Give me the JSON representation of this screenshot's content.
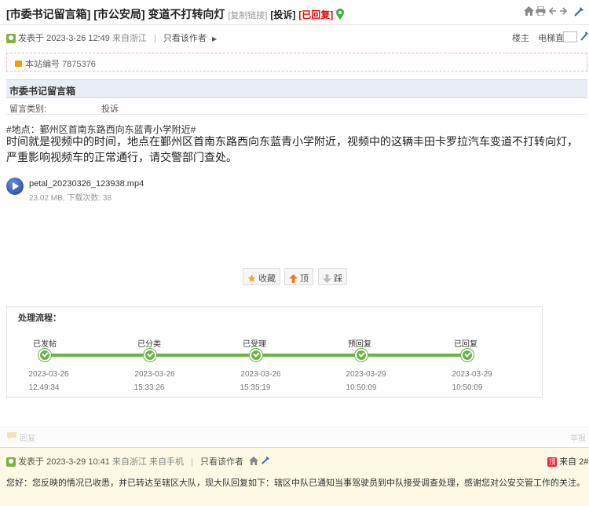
{
  "thread": {
    "title_cat": "[市委书记留言箱]",
    "title_dept": "[市公安局]",
    "title_text": "变道不打转向灯",
    "copy_link": "[复制链接]",
    "type_tag": "[投诉]",
    "status_tag": "[已回复]"
  },
  "post": {
    "posted": "发表于 2023-3-26 12:49",
    "from": "来自浙江",
    "only_author": "只看该作者",
    "floor_label": "楼主",
    "elevator_label": "电梯直达",
    "serial": "本站编号 7875376",
    "box_title": "市委书记留言箱",
    "category_label": "留言类别:",
    "category_value": "投诉",
    "location": "#地点：鄞州区首南东路西向东蓝青小学附近#",
    "content": "时间就是视频中的时间，地点在鄞州区首南东路西向东蓝青小学附近，视频中的这辆丰田卡罗拉汽车变道不打转向灯，严重影响视频车的正常通行，请交警部门查处。",
    "attachment_name": "petal_20230326_123938.mp4",
    "attachment_meta": "23.02 MB, 下载次数: 38",
    "btn_fav": "收藏",
    "btn_up": "顶",
    "btn_down": "踩"
  },
  "process": {
    "title": "处理流程：",
    "steps": [
      {
        "label": "已发帖",
        "date": "2023-03-26",
        "time": "12:49:34"
      },
      {
        "label": "已分类",
        "date": "2023-03-26",
        "time": "15:33:26"
      },
      {
        "label": "已受理",
        "date": "2023-03-26",
        "time": "15:35:19"
      },
      {
        "label": "预回复",
        "date": "2023-03-29",
        "time": "10:50:09"
      },
      {
        "label": "已回复",
        "date": "2023-03-29",
        "time": "10:50:09"
      }
    ]
  },
  "replybar": {
    "reply": "回复",
    "report": "举报"
  },
  "reply": {
    "posted": "发表于 2023-3-29 10:41",
    "from": "来自浙江 来自手机",
    "only_author": "只看该作者",
    "badge": "顶",
    "floor": "来自 2#",
    "text": "您好：您反映的情况已收悉，并已转达至辖区大队，现大队回复如下：辖区中队已通知当事驾驶员到中队接受调查处理，感谢您对公安交管工作的关注。"
  },
  "colors": {
    "accent_green": "#6ab344",
    "status_red": "#e00000",
    "header_blue": "#e9eef4",
    "reply_bg": "#fdf9e4"
  }
}
